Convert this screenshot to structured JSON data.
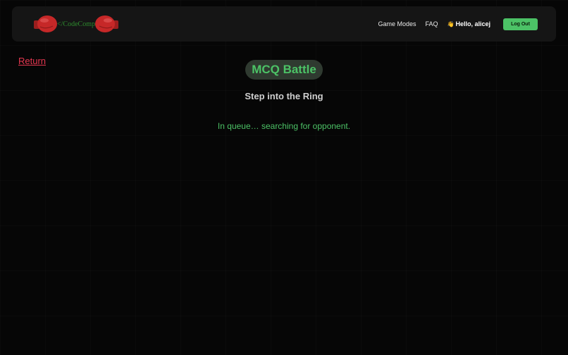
{
  "header": {
    "logo_text": "</CodeComp",
    "nav": {
      "game_modes": "Game Modes",
      "faq": "FAQ",
      "wave_emoji": "👋",
      "greeting": "Hello, alicej",
      "logout_label": "Log Out"
    }
  },
  "main": {
    "return_label": "Return",
    "mode_title": "MCQ Battle",
    "subtitle": "Step into the Ring",
    "status_text": "In queue… searching for opponent."
  },
  "colors": {
    "accent_green": "#4cc266",
    "return_red": "#e53750",
    "navbar_bg": "#151515",
    "page_bg": "#060606"
  },
  "icons": {
    "left_logo": "boxing-glove-icon",
    "right_logo": "boxing-glove-icon",
    "greeting": "waving-hand-icon"
  }
}
